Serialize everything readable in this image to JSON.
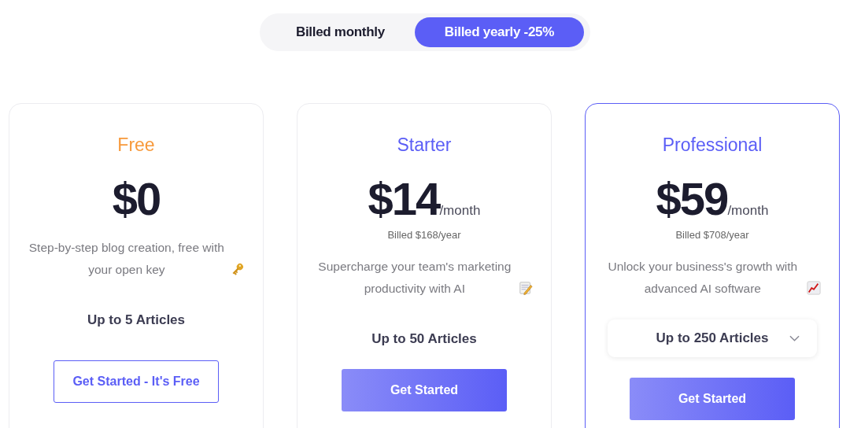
{
  "billing_toggle": [
    {
      "label": "Billed monthly",
      "selected": false
    },
    {
      "label": "Billed yearly -25%",
      "selected": true
    }
  ],
  "plans": [
    {
      "name": "Free",
      "color": "#f7993a",
      "selected": false,
      "price": "$0",
      "description": "Step-by-step blog creation, free with your open key",
      "articles": {
        "kind": "text",
        "label": "Up to 5 Articles"
      },
      "button": {
        "kind": "outline",
        "label": "Get Started - It's Free"
      }
    },
    {
      "name": "Starter",
      "color": "#5b5ef6",
      "selected": false,
      "price": "$14",
      "unit": "/month",
      "billed": "Billed $168/year",
      "description": "Supercharge your team's marketing productivity with AI",
      "articles": {
        "kind": "text",
        "label": "Up to 50 Articles"
      },
      "button": {
        "kind": "filled",
        "label": "Get Started"
      }
    },
    {
      "name": "Professional",
      "color": "#5b5ef6",
      "selected": true,
      "price": "$59",
      "unit": "/month",
      "billed": "Billed $708/year",
      "description": "Unlock your business's growth with advanced AI software",
      "articles": {
        "kind": "dropdown",
        "label": "Up to 250 Articles"
      },
      "button": {
        "kind": "filled",
        "label": "Get Started"
      }
    }
  ]
}
